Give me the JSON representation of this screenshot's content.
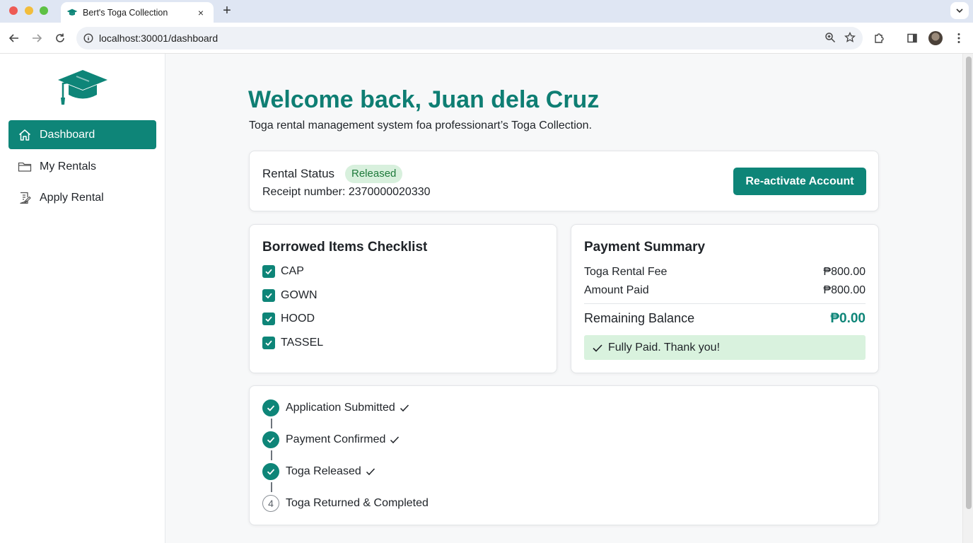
{
  "browser": {
    "tab_title": "Bert's Toga Collection",
    "tab_close": "×",
    "new_tab": "+",
    "url": "localhost:30001/dashboard"
  },
  "sidebar": {
    "items": [
      {
        "label": "Dashboard",
        "icon": "home-icon",
        "active": true
      },
      {
        "label": "My Rentals",
        "icon": "folder-icon",
        "active": false
      },
      {
        "label": "Apply Rental",
        "icon": "form-icon",
        "active": false
      }
    ]
  },
  "header": {
    "welcome": "Welcome back, Juan dela Cruz",
    "subtitle": "Toga rental management system foa professionart’s Toga Collection."
  },
  "rental_status": {
    "title": "Rental Status",
    "badge": "Released",
    "receipt_label": "Receipt number: 2370000020330",
    "button_label": "Re-activate Account"
  },
  "checklist": {
    "title": "Borrowed Items Checklist",
    "items": [
      "CAP",
      "GOWN",
      "HOOD",
      "TASSEL"
    ]
  },
  "payment": {
    "title": "Payment Summary",
    "fee_label": "Toga Rental Fee",
    "fee_value": "₱800.00",
    "paid_label": "Amount Paid",
    "paid_value": "₱800.00",
    "balance_label": "Remaining Balance",
    "balance_value": "₱0.00",
    "banner": "Fully Paid. Thank you!"
  },
  "timeline": {
    "steps": [
      {
        "label": "Application Submitted",
        "done": true
      },
      {
        "label": "Payment Confirmed",
        "done": true
      },
      {
        "label": "Toga Released",
        "done": true
      },
      {
        "label": "Toga Returned & Completed",
        "done": false,
        "number": "4"
      }
    ]
  },
  "colors": {
    "accent": "#0e8578",
    "heading": "#0e7e73",
    "badge_bg": "#d8f0dd",
    "success_bg": "#d9f2de"
  }
}
